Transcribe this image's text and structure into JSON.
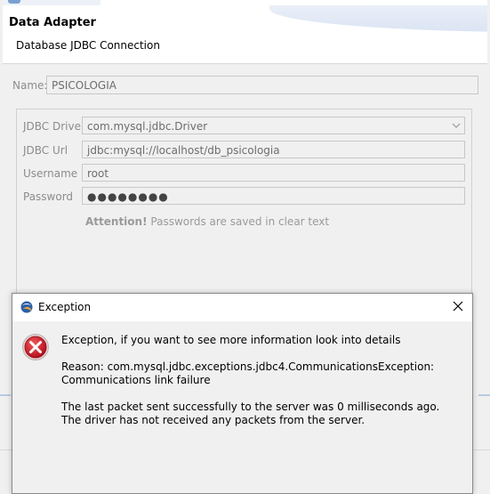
{
  "wizard": {
    "title": "Data Adapter",
    "subtitle": "Database JDBC Connection",
    "name_label": "Name:",
    "name_value": "PSICOLOGIA",
    "fields": {
      "driver_label": "JDBC Driver",
      "driver_value": "com.mysql.jdbc.Driver",
      "url_label": "JDBC Url",
      "url_value": "jdbc:mysql://localhost/db_psicologia",
      "username_label": "Username",
      "username_value": "root",
      "password_label": "Password",
      "password_value": "●●●●●●●●"
    },
    "attention_bold": "Attention!",
    "attention_text": "Passwords are saved in clear text"
  },
  "dialog": {
    "title": "Exception",
    "line1": "Exception, if you want to see more information look into details",
    "line2": "Reason: com.mysql.jdbc.exceptions.jdbc4.CommunicationsException: Communications link failure",
    "line3": "The last packet sent successfully to the server was 0 milliseconds ago. The driver has not received any packets from the server."
  },
  "icons": {
    "app": "eclipse-icon",
    "close": "close-icon",
    "error": "error-icon",
    "dropdown": "chevron-down-icon"
  },
  "colors": {
    "error_red": "#c8102e",
    "header_blue": "#d7e1f2"
  }
}
